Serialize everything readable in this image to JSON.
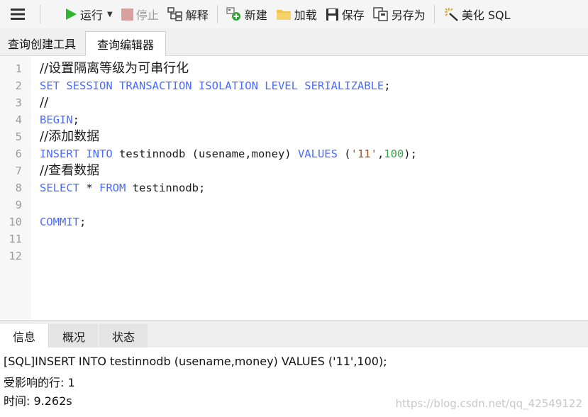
{
  "toolbar": {
    "run": "运行",
    "stop": "停止",
    "explain": "解释",
    "new": "新建",
    "load": "加载",
    "save": "保存",
    "save_as": "另存为",
    "beautify": "美化 SQL"
  },
  "tabs": [
    {
      "label": "查询创建工具"
    },
    {
      "label": "查询编辑器"
    }
  ],
  "editor": {
    "lines": [
      {
        "n": "1",
        "tokens": [
          {
            "t": "//设置隔离等级为可串行化",
            "c": "cm"
          }
        ]
      },
      {
        "n": "2",
        "tokens": [
          {
            "t": "SET SESSION TRANSACTION ISOLATION LEVEL SERIALIZABLE",
            "c": "kw"
          },
          {
            "t": ";",
            "c": "op"
          }
        ]
      },
      {
        "n": "3",
        "tokens": [
          {
            "t": "//",
            "c": "cm"
          }
        ]
      },
      {
        "n": "4",
        "tokens": [
          {
            "t": "BEGIN",
            "c": "kw"
          },
          {
            "t": ";",
            "c": "op"
          }
        ]
      },
      {
        "n": "5",
        "tokens": [
          {
            "t": "//添加数据",
            "c": "cm"
          }
        ]
      },
      {
        "n": "6",
        "tokens": [
          {
            "t": "INSERT INTO",
            "c": "kw"
          },
          {
            "t": " testinnodb (usename,money) ",
            "c": "op"
          },
          {
            "t": "VALUES",
            "c": "kw"
          },
          {
            "t": " (",
            "c": "op"
          },
          {
            "t": "'11'",
            "c": "str"
          },
          {
            "t": ",",
            "c": "op"
          },
          {
            "t": "100",
            "c": "num"
          },
          {
            "t": ");",
            "c": "op"
          }
        ]
      },
      {
        "n": "7",
        "tokens": [
          {
            "t": "//查看数据",
            "c": "cm"
          }
        ]
      },
      {
        "n": "8",
        "tokens": [
          {
            "t": "SELECT",
            "c": "kw"
          },
          {
            "t": " * ",
            "c": "op"
          },
          {
            "t": "FROM",
            "c": "kw"
          },
          {
            "t": " testinnodb;",
            "c": "op"
          }
        ]
      },
      {
        "n": "9",
        "tokens": []
      },
      {
        "n": "10",
        "tokens": [
          {
            "t": "COMMIT",
            "c": "kw"
          },
          {
            "t": ";",
            "c": "op"
          }
        ]
      },
      {
        "n": "11",
        "tokens": []
      },
      {
        "n": "12",
        "tokens": []
      }
    ]
  },
  "bottom_tabs": [
    {
      "label": "信息"
    },
    {
      "label": "概况"
    },
    {
      "label": "状态"
    }
  ],
  "messages": [
    "[SQL]INSERT INTO testinnodb (usename,money) VALUES ('11',100);",
    "受影响的行: 1",
    "时间: 9.262s"
  ],
  "watermark": "https://blog.csdn.net/qq_42549122",
  "colors": {
    "keyword": "#4a6cff",
    "string": "#a2551f",
    "number": "#3fa24a",
    "run_icon": "#2fb52f",
    "stop_icon": "#d9a0a0"
  },
  "icons": [
    "menu-icon",
    "play-icon",
    "dropdown-caret-icon",
    "stop-icon",
    "explain-icon",
    "new-query-icon",
    "folder-icon",
    "save-icon",
    "save-as-icon",
    "beautify-wand-icon"
  ]
}
